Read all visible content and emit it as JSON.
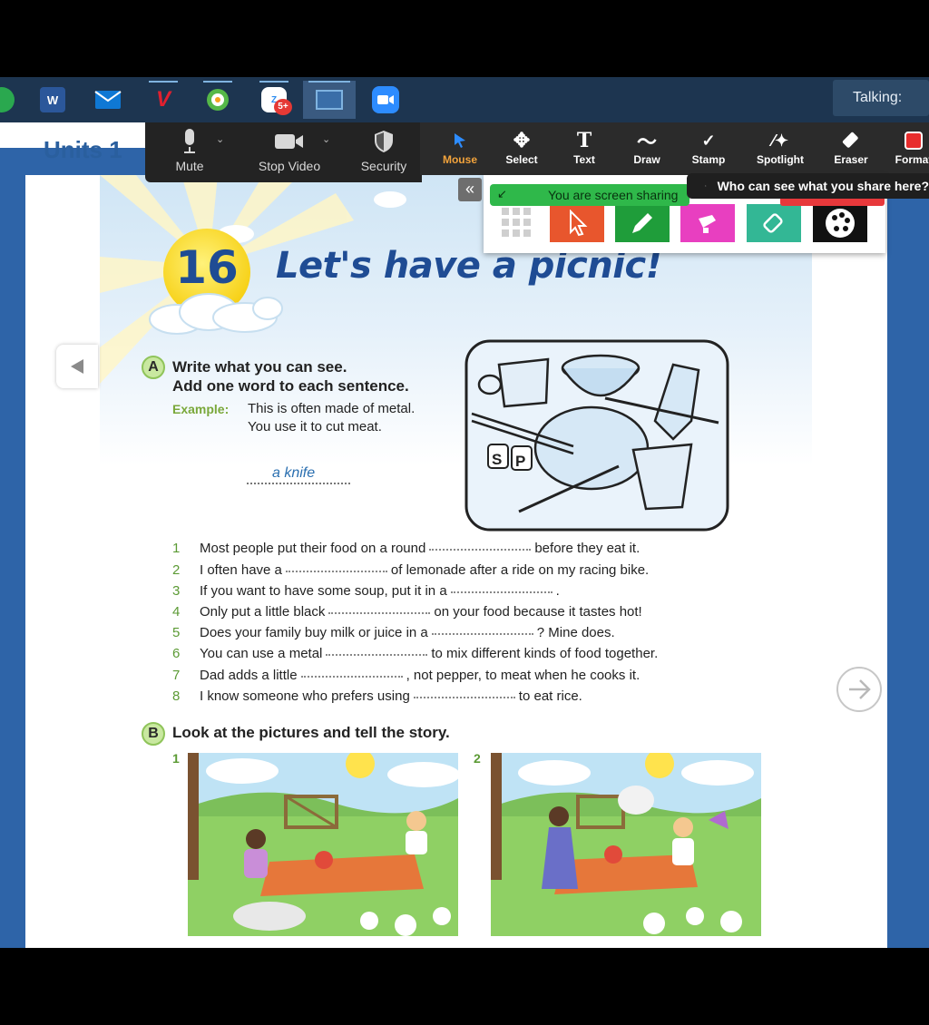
{
  "taskbar": {
    "talking_label": "Talking:",
    "apps": [
      {
        "name": "word-icon",
        "letter": "W",
        "color": "#2b579a"
      },
      {
        "name": "mail-icon",
        "color": "#0f78d4"
      },
      {
        "name": "v-app-icon",
        "letter": "V",
        "color": "#c8202f"
      },
      {
        "name": "green-app-icon",
        "color": "#4caf50"
      },
      {
        "name": "zalo-icon",
        "badge": "5+",
        "color": "#2d8cf0"
      },
      {
        "name": "viewer-app-icon",
        "color": "#3a6ea8"
      },
      {
        "name": "zoom-icon",
        "color": "#2d8cff"
      }
    ]
  },
  "book": {
    "units_title": "Units 1",
    "lesson_number": "16",
    "lesson_title": "Let's have a picnic!"
  },
  "zoom_controls": {
    "mute": "Mute",
    "stop_video": "Stop Video",
    "security": "Security"
  },
  "annotate_toolbar": {
    "items": [
      {
        "label": "Mouse",
        "icon": "cursor-icon",
        "selected": true
      },
      {
        "label": "Select",
        "icon": "move-icon"
      },
      {
        "label": "Text",
        "icon": "text-icon"
      },
      {
        "label": "Draw",
        "icon": "draw-icon"
      },
      {
        "label": "Stamp",
        "icon": "stamp-icon"
      },
      {
        "label": "Spotlight",
        "icon": "spotlight-icon"
      },
      {
        "label": "Eraser",
        "icon": "eraser-icon"
      },
      {
        "label": "Format",
        "icon": "format-icon"
      }
    ]
  },
  "share": {
    "collapse_glyph": "«",
    "status": "You are screen sharing",
    "who_can_see": "Who can see what you share here?"
  },
  "section_a": {
    "letter": "A",
    "instruction_1": "Write what you can see.",
    "instruction_2": "Add one word to each sentence.",
    "example_label": "Example:",
    "example_1": "This is often made of metal.",
    "example_2": "You use it to cut meat.",
    "example_answer": "a knife",
    "questions": [
      {
        "n": "1",
        "before": "Most people put their food on a round",
        "after": "before they eat it."
      },
      {
        "n": "2",
        "before": "I often have a",
        "after": "of lemonade after a ride on my racing bike."
      },
      {
        "n": "3",
        "before": "If you want to have some soup, put it in a",
        "after": "."
      },
      {
        "n": "4",
        "before": "Only put a little black",
        "after": "on your food because it tastes hot!"
      },
      {
        "n": "5",
        "before": "Does your family buy milk or juice in a",
        "after": "? Mine does."
      },
      {
        "n": "6",
        "before": "You can use a metal",
        "after": "to mix different kinds of food together."
      },
      {
        "n": "7",
        "before": "Dad adds a little",
        "after": ", not pepper, to meat when he cooks it."
      },
      {
        "n": "8",
        "before": "I know someone who prefers using",
        "after": "to eat rice."
      }
    ]
  },
  "section_b": {
    "letter": "B",
    "instruction": "Look at the pictures and tell the story.",
    "pictures": [
      "1",
      "2"
    ]
  }
}
